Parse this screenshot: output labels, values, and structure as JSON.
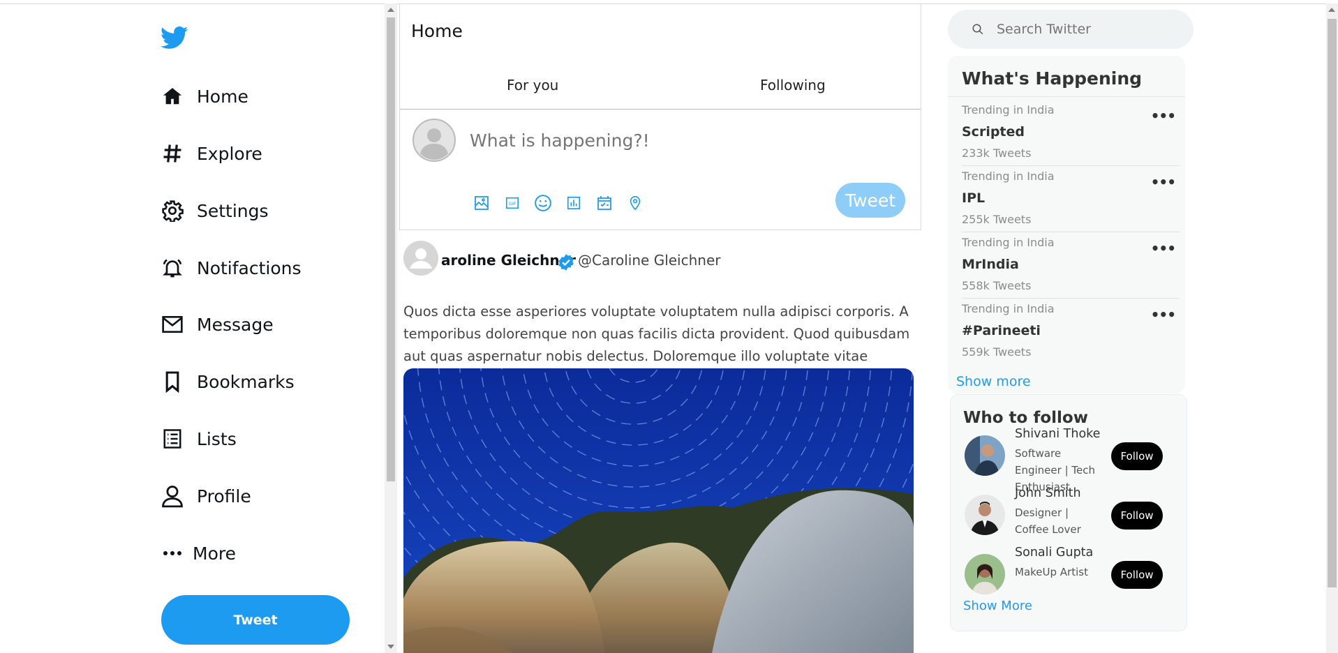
{
  "sidebar": {
    "logo_icon": "twitter-bird-icon",
    "brand_color": "#1d9bf0",
    "items": [
      {
        "label": "Home",
        "icon": "home-icon"
      },
      {
        "label": "Explore",
        "icon": "hashtag-icon"
      },
      {
        "label": "Settings",
        "icon": "gear-icon"
      },
      {
        "label": "Notifactions",
        "icon": "bell-icon"
      },
      {
        "label": "Message",
        "icon": "mail-icon"
      },
      {
        "label": "Bookmarks",
        "icon": "bookmark-icon"
      },
      {
        "label": "Lists",
        "icon": "list-icon"
      },
      {
        "label": "Profile",
        "icon": "user-icon"
      },
      {
        "label": "More",
        "icon": "ellipsis-icon"
      }
    ],
    "tweet_label": "Tweet"
  },
  "main": {
    "title": "Home",
    "tabs": [
      {
        "label": "For you"
      },
      {
        "label": "Following"
      }
    ],
    "compose": {
      "placeholder": "What is happening?!",
      "tools": [
        "image-icon",
        "gif-icon",
        "emoji-icon",
        "poll-icon",
        "schedule-icon",
        "location-icon"
      ],
      "tweet_label": "Tweet"
    },
    "post": {
      "name": "aroline Gleichner",
      "handle": "@Caroline Gleichner",
      "text": "Quos dicta esse asperiores voluptate voluptatem nulla adipisci corporis. A temporibus doloremque non quas facilis dicta provident. Quod quibusdam aut quas aspernatur nobis delectus. Doloremque illo voluptate vitae dignissimos."
    }
  },
  "search": {
    "placeholder": "Search Twitter"
  },
  "happening": {
    "title": "What's Happening",
    "trends": [
      {
        "category": "Trending in India",
        "name": "Scripted",
        "count": "233k Tweets"
      },
      {
        "category": "Trending in India",
        "name": "IPL",
        "count": "255k Tweets"
      },
      {
        "category": "Trending in India",
        "name": "MrIndia",
        "count": "558k Tweets"
      },
      {
        "category": "Trending in India",
        "name": "#Parineeti",
        "count": "559k Tweets"
      }
    ],
    "show_more": "Show more"
  },
  "who_to_follow": {
    "title": "Who to follow",
    "users": [
      {
        "name": "Shivani Thoke",
        "bio": "Software Engineer | Tech Enthusiast",
        "follow": "Follow"
      },
      {
        "name": "John Smith",
        "bio": "Designer | Coffee Lover",
        "follow": "Follow"
      },
      {
        "name": "Sonali Gupta",
        "bio": "MakeUp Artist",
        "follow": "Follow"
      }
    ],
    "show_more": "Show More"
  }
}
